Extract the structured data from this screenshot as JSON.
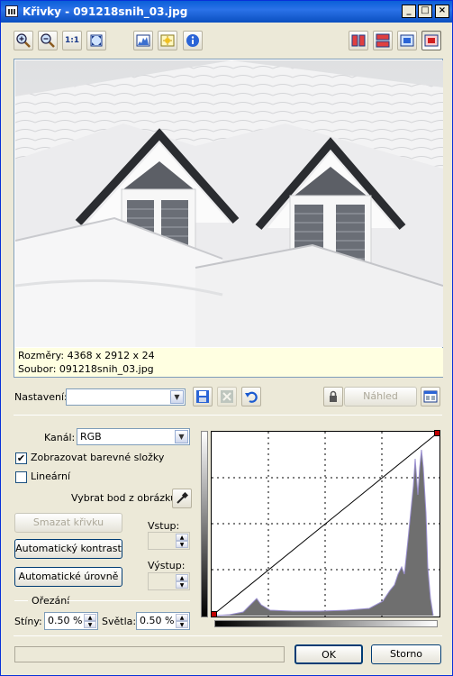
{
  "window": {
    "title": "Křivky - 091218snih_03.jpg",
    "controls": {
      "minimize": "_",
      "maximize": "□",
      "close": "×"
    }
  },
  "toolbar": {
    "left_icons": [
      "zoom-in-icon",
      "zoom-out-icon",
      "actual-size-icon",
      "fit-window-icon",
      "histogram-icon",
      "auto-adjust-icon",
      "info-icon"
    ],
    "actual_size_text": "1:1",
    "right_icons": [
      "split-vertical-icon",
      "split-horizontal-icon",
      "view-original-icon",
      "view-result-icon"
    ]
  },
  "preview": {
    "dimensions_label": "Rozměry: 4368 x 2912 x 24",
    "file_label": "Soubor: 091218snih_03.jpg"
  },
  "preset": {
    "label": "Nastavení:",
    "value": "",
    "preview_button": "Náhled"
  },
  "channel": {
    "label": "Kanál:",
    "value": "RGB"
  },
  "options": {
    "show_color_components": {
      "label": "Zobrazovat barevné složky",
      "checked": true
    },
    "linear": {
      "label": "Lineární",
      "checked": false
    }
  },
  "pick_point_label": "Vybrat bod z obrázku:",
  "buttons": {
    "delete_curve": "Smazat křivku",
    "auto_contrast": "Automatický kontrast",
    "auto_levels": "Automatické úrovně",
    "ok": "OK",
    "cancel": "Storno"
  },
  "input_label": "Vstup:",
  "output_label": "Výstup:",
  "clipping": {
    "group_label": "Ořezání",
    "shadows_label": "Stíny:",
    "shadows_value": "0.50 %",
    "highlights_label": "Světla:",
    "highlights_value": "0.50 %"
  },
  "colors": {
    "title_bar": "#0a5fd8",
    "dialog_bg": "#ece9d8",
    "info_bg": "#ffffe1",
    "control_point": "#c00000"
  }
}
